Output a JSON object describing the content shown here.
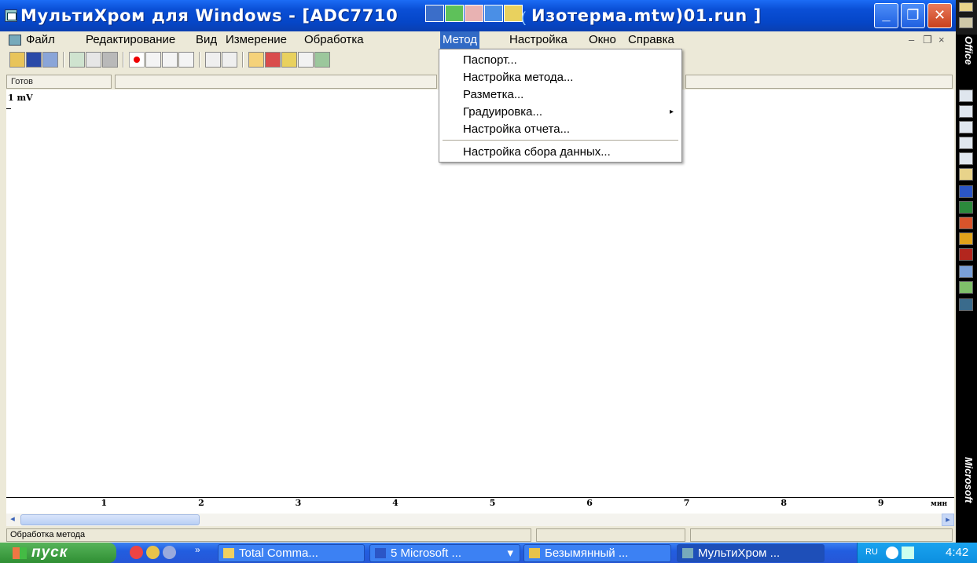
{
  "window": {
    "title_left": "МультиХром для Windows - [ADC7710",
    "title_right": "Изотерма.mtw)01.run ]",
    "title_fragment": "(",
    "min_label": "_",
    "max_label": "❐",
    "close_label": "✕"
  },
  "menubar": {
    "items": [
      "Файл",
      "Редактирование",
      "Вид",
      "Измерение",
      "Обработка",
      "Метод",
      "Настройка",
      "Окно",
      "Справка"
    ],
    "mdi_min": "–",
    "mdi_restore": "❐",
    "mdi_close": "×"
  },
  "ready_status": "Готов",
  "dropdown": {
    "items": [
      "Паспорт...",
      "Настройка метода...",
      "Разметка...",
      "Градуировка...",
      "Настройка отчета...",
      "Настройка сбора данных..."
    ],
    "submenu_arrow": "▸"
  },
  "chart_data": {
    "type": "line",
    "ylabel": "1 mV",
    "xlabel": "мин",
    "x_ticks": [
      "1",
      "2",
      "3",
      "4",
      "5",
      "6",
      "7",
      "8",
      "9"
    ],
    "xlim": [
      0,
      9.6
    ],
    "series": []
  },
  "statusbar": {
    "message": "Обработка метода"
  },
  "officebar": {
    "top_label": "Office",
    "bottom_label": "Microsoft"
  },
  "taskbar": {
    "start_label": "пуск",
    "chevron": "»",
    "tasks": [
      "Total Comma...",
      "5 Microsoft ...",
      "Безымянный ...",
      "МультиХром ..."
    ],
    "task_dropdown": "▾",
    "lang": "RU",
    "clock": "4:42"
  },
  "colors": {
    "title_bar": "#0546c8",
    "menu_highlight": "#316ac5",
    "taskbar": "#225ee0",
    "start_button": "#2f8f33"
  }
}
